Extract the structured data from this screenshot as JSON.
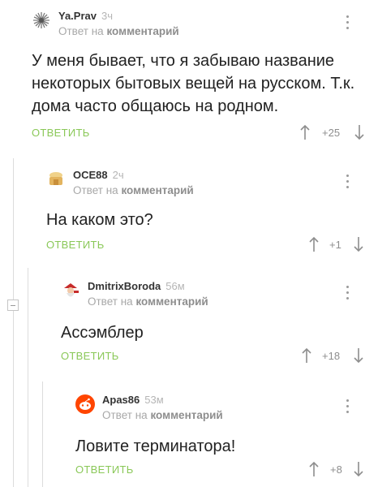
{
  "reply_prefix": "Ответ на",
  "reply_link": "комментарий",
  "comments": [
    {
      "author": "Ya.Prav",
      "age": "3ч",
      "text": "У меня бывает, что я забываю название некоторых бытовых вещей на русском. Т.к. дома часто общаюсь на родном.",
      "reply_label": "ОТВЕТИТЬ",
      "rating": "+25"
    },
    {
      "author": "OCE88",
      "age": "2ч",
      "text": "На каком это?",
      "reply_label": "ОТВЕТИТЬ",
      "rating": "+1"
    },
    {
      "author": "DmitrixBoroda",
      "age": "56м",
      "text": "Ассэмблер",
      "reply_label": "ОТВЕТИТЬ",
      "rating": "+18"
    },
    {
      "author": "Apas86",
      "age": "53м",
      "text": "Ловите терминатора!",
      "reply_label": "ОТВЕТИТЬ",
      "rating": "+8"
    }
  ],
  "colors": {
    "reply_button": "#8ac858",
    "thread_line": "#dcdcdc",
    "meta_text": "#a8a8a8"
  }
}
